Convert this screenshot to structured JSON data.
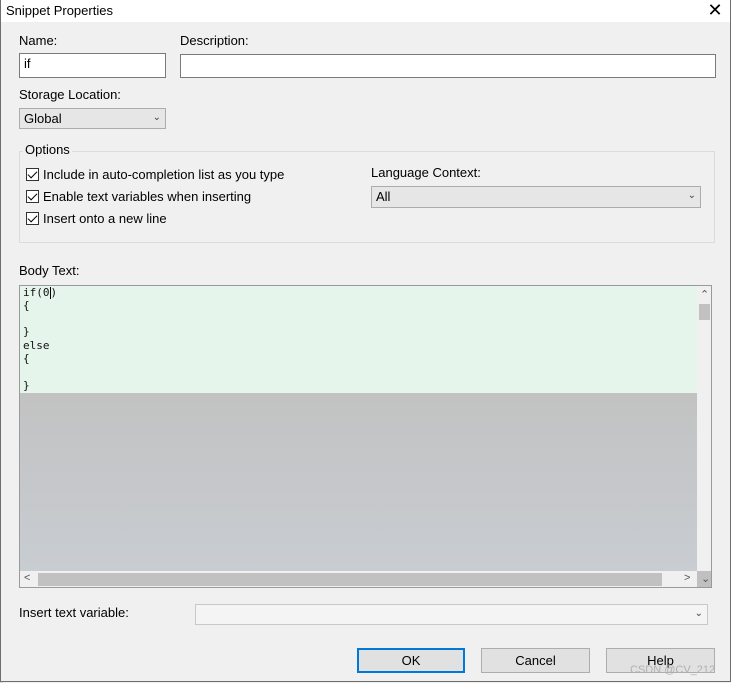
{
  "window": {
    "title": "Snippet Properties",
    "close_glyph": "✕"
  },
  "name": {
    "label": "Name:",
    "value": "if"
  },
  "description": {
    "label": "Description:",
    "value": ""
  },
  "storage": {
    "label": "Storage Location:",
    "value": "Global"
  },
  "options": {
    "title": "Options",
    "checkboxes": [
      {
        "label": "Include in auto-completion list as you type",
        "checked": true
      },
      {
        "label": "Enable text variables when inserting",
        "checked": true
      },
      {
        "label": "Insert onto a new line",
        "checked": true
      }
    ],
    "language_label": "Language Context:",
    "language_value": "All"
  },
  "body": {
    "label": "Body Text:",
    "lines": [
      "if(0",
      "{",
      "",
      "}",
      "else",
      "{",
      "",
      "}"
    ],
    "caret_after": ")"
  },
  "insert_var": {
    "label": "Insert text variable:",
    "value": ""
  },
  "buttons": {
    "ok": "OK",
    "cancel": "Cancel",
    "help": "Help"
  },
  "watermark": "CSDN @CV_212",
  "icons": {
    "dropdown": "chevron-down-icon",
    "close": "close-icon"
  }
}
